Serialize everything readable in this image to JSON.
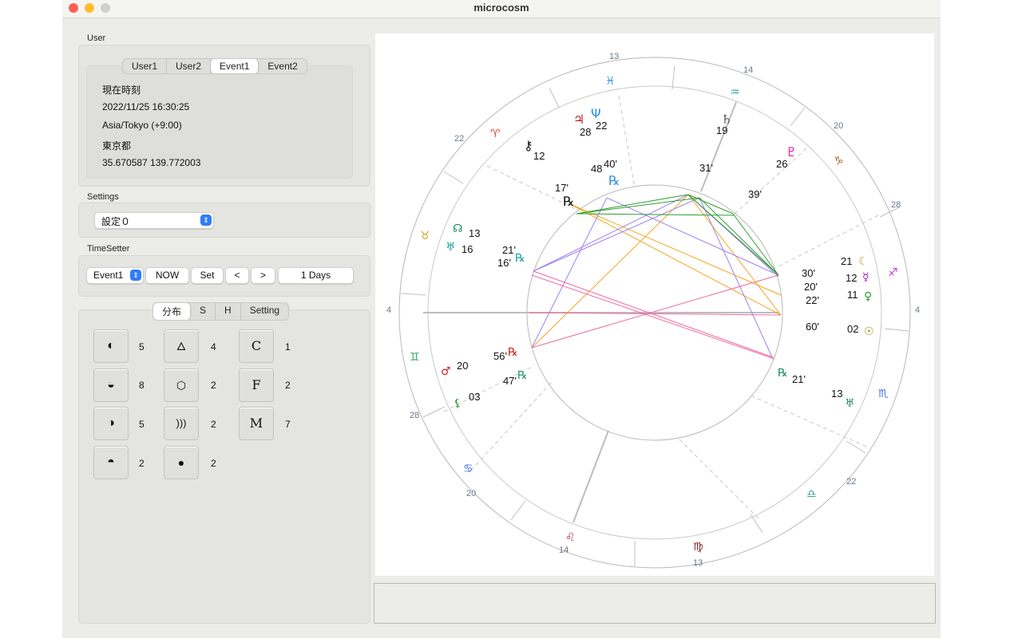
{
  "window": {
    "title": "microcosm"
  },
  "user": {
    "label": "User",
    "tabs": [
      "User1",
      "User2",
      "Event1",
      "Event2"
    ],
    "info": [
      "現在時刻",
      "2022/11/25 16:30:25",
      "Asia/Tokyo (+9:00)",
      "東京都",
      "35.670587 139.772003"
    ]
  },
  "settings": {
    "label": "Settings",
    "selected": "設定０"
  },
  "timesetter": {
    "label": "TimeSetter",
    "event_select": "Event1",
    "now": "NOW",
    "set": "Set",
    "prev": "<",
    "next": ">",
    "step": "1 Days"
  },
  "dist": {
    "tabs": [
      "分布",
      "S",
      "H",
      "Setting"
    ],
    "col1": [
      "5",
      "8",
      "5",
      "2"
    ],
    "col2": [
      "4",
      "2",
      "2",
      "2"
    ],
    "col3_letters": [
      "C",
      "F",
      "M"
    ],
    "col3": [
      "1",
      "2",
      "7"
    ],
    "col1_icons": [
      "half-circle-left-icon",
      "half-circle-top-icon",
      "half-circle-right-icon",
      "half-circle-bottom-icon"
    ],
    "col2_icons": [
      "fire-icon",
      "cube-icon",
      "air-waves-icon",
      "water-drop-icon"
    ]
  },
  "chart": {
    "house_numbers": [
      "13",
      "14",
      "20",
      "28",
      "4",
      "22",
      "13",
      "14",
      "20",
      "28",
      "4",
      "22"
    ],
    "planet_labels": {
      "mc_side": [
        "28",
        "22",
        "48",
        "40'",
        "12",
        "17'",
        "19",
        "31'",
        "26",
        "39'"
      ],
      "right_side": [
        "30'",
        "21",
        "20'",
        "12",
        "22'",
        "11",
        "60'",
        "02",
        "21'",
        "13"
      ],
      "left_side": [
        "13",
        "16",
        "21'",
        "16'",
        "56'",
        "20",
        "47'",
        "03"
      ]
    },
    "glyphs": {
      "jupiter": "♃",
      "neptune": "Ψ",
      "saturn": "♄",
      "chiron": "⚷",
      "pluto": "♇",
      "moon": "☾",
      "mercury": "☿",
      "venus": "♀",
      "sun": "☉",
      "mars": "♂",
      "node": "☊",
      "uranus": "♅",
      "retro": "℞",
      "lilith": "⚸"
    },
    "signs": [
      "♓",
      "♒",
      "♑",
      "♐",
      "♏",
      "♎",
      "♍",
      "♌",
      "♋",
      "♊",
      "♉",
      "♈"
    ]
  }
}
